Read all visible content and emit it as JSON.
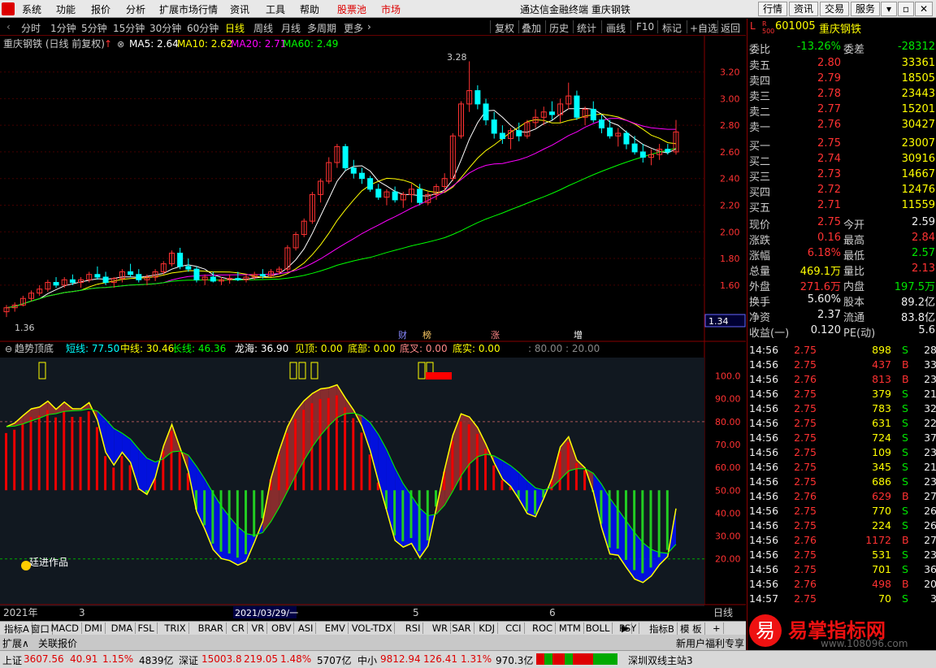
{
  "menu": {
    "items": [
      "系统",
      "功能",
      "报价",
      "分析",
      "扩展市场行情",
      "资讯",
      "工具",
      "帮助"
    ],
    "stock_pool": "股票池",
    "market": "市场",
    "title": "通达信金融终端  重庆钢铁",
    "right_buttons": [
      "行情",
      "资讯",
      "交易",
      "服务"
    ]
  },
  "toolbar": {
    "periods": [
      "分时",
      "1分钟",
      "5分钟",
      "15分钟",
      "30分钟",
      "60分钟",
      "日线",
      "周线",
      "月线",
      "多周期",
      "更多"
    ],
    "active": "日线",
    "tools": [
      "复权",
      "叠加",
      "历史",
      "统计",
      "画线",
      "F10",
      "标记",
      "+自选",
      "返回"
    ]
  },
  "main_chart": {
    "title": "重庆钢铁 (日线 前复权)",
    "ma5": "MA5: 2.64",
    "ma10": "MA10: 2.62",
    "ma20": "MA20: 2.71",
    "ma60": "MA60: 2.49",
    "high_label": "3.28",
    "low_label": "1.36",
    "price_axis": [
      "3.20",
      "3.00",
      "2.80",
      "2.60",
      "2.40",
      "2.20",
      "2.00",
      "1.80",
      "1.60"
    ],
    "current_price_box": "1.34",
    "event_tags": [
      "财",
      "榜",
      "涨",
      "增"
    ]
  },
  "indicator": {
    "name": "趋势顶底",
    "short": "短线: 77.50",
    "mid": "中线: 30.46",
    "long": "长线: 46.36",
    "dragon": "龙海: 36.90",
    "top": "见顶: 0.00",
    "bottom": "底部: 0.00",
    "cross": "底叉: 0.00",
    "real": "底实: 0.00",
    "ref": ": 80.00 : 20.00",
    "axis": [
      "100.0",
      "90.00",
      "80.00",
      "70.00",
      "60.00",
      "50.00",
      "40.00",
      "30.00",
      "20.00"
    ],
    "watermark": "廷进作品"
  },
  "date_axis": {
    "labels": [
      "2021年",
      "3",
      "2021/03/29/一",
      "5",
      "6"
    ],
    "period": "日线"
  },
  "chart_data": {
    "type": "candlestick",
    "title": "重庆钢铁 (日线 前复权)",
    "ylim": [
      1.3,
      3.35
    ],
    "candles": [
      [
        1.4,
        1.45,
        1.36,
        1.43
      ],
      [
        1.43,
        1.47,
        1.4,
        1.45
      ],
      [
        1.45,
        1.52,
        1.44,
        1.5
      ],
      [
        1.5,
        1.56,
        1.48,
        1.54
      ],
      [
        1.54,
        1.6,
        1.52,
        1.57
      ],
      [
        1.57,
        1.64,
        1.55,
        1.62
      ],
      [
        1.62,
        1.66,
        1.58,
        1.6
      ],
      [
        1.6,
        1.66,
        1.58,
        1.64
      ],
      [
        1.64,
        1.68,
        1.6,
        1.62
      ],
      [
        1.62,
        1.66,
        1.58,
        1.64
      ],
      [
        1.64,
        1.7,
        1.62,
        1.68
      ],
      [
        1.68,
        1.74,
        1.64,
        1.66
      ],
      [
        1.66,
        1.7,
        1.6,
        1.62
      ],
      [
        1.62,
        1.66,
        1.58,
        1.65
      ],
      [
        1.65,
        1.72,
        1.62,
        1.7
      ],
      [
        1.7,
        1.76,
        1.66,
        1.68
      ],
      [
        1.68,
        1.72,
        1.62,
        1.64
      ],
      [
        1.64,
        1.68,
        1.6,
        1.66
      ],
      [
        1.66,
        1.72,
        1.63,
        1.7
      ],
      [
        1.7,
        1.78,
        1.68,
        1.76
      ],
      [
        1.76,
        1.86,
        1.74,
        1.84
      ],
      [
        1.84,
        1.88,
        1.72,
        1.74
      ],
      [
        1.74,
        1.8,
        1.7,
        1.72
      ],
      [
        1.72,
        1.74,
        1.62,
        1.64
      ],
      [
        1.64,
        1.68,
        1.6,
        1.66
      ],
      [
        1.66,
        1.7,
        1.62,
        1.63
      ],
      [
        1.63,
        1.66,
        1.6,
        1.64
      ],
      [
        1.64,
        1.68,
        1.61,
        1.65
      ],
      [
        1.65,
        1.7,
        1.63,
        1.64
      ],
      [
        1.64,
        1.68,
        1.62,
        1.66
      ],
      [
        1.66,
        1.7,
        1.64,
        1.68
      ],
      [
        1.68,
        1.72,
        1.65,
        1.67
      ],
      [
        1.67,
        1.72,
        1.66,
        1.7
      ],
      [
        1.7,
        1.74,
        1.68,
        1.72
      ],
      [
        1.72,
        1.9,
        1.7,
        1.88
      ],
      [
        1.88,
        2.0,
        1.86,
        1.98
      ],
      [
        1.98,
        2.1,
        1.96,
        2.08
      ],
      [
        2.08,
        2.3,
        2.06,
        2.28
      ],
      [
        2.28,
        2.4,
        2.22,
        2.38
      ],
      [
        2.38,
        2.56,
        2.36,
        2.52
      ],
      [
        2.52,
        2.66,
        2.48,
        2.64
      ],
      [
        2.64,
        2.66,
        2.46,
        2.48
      ],
      [
        2.48,
        2.54,
        2.4,
        2.44
      ],
      [
        2.44,
        2.48,
        2.36,
        2.4
      ],
      [
        2.4,
        2.42,
        2.3,
        2.32
      ],
      [
        2.32,
        2.36,
        2.24,
        2.26
      ],
      [
        2.26,
        2.32,
        2.2,
        2.3
      ],
      [
        2.3,
        2.34,
        2.22,
        2.24
      ],
      [
        2.24,
        2.3,
        2.18,
        2.28
      ],
      [
        2.28,
        2.36,
        2.22,
        2.32
      ],
      [
        2.32,
        2.36,
        2.2,
        2.22
      ],
      [
        2.22,
        2.3,
        2.2,
        2.28
      ],
      [
        2.28,
        2.36,
        2.24,
        2.34
      ],
      [
        2.34,
        2.44,
        2.3,
        2.4
      ],
      [
        2.4,
        2.74,
        2.38,
        2.72
      ],
      [
        2.72,
        2.98,
        2.7,
        2.96
      ],
      [
        2.96,
        3.28,
        2.9,
        3.06
      ],
      [
        3.06,
        3.1,
        2.92,
        2.96
      ],
      [
        2.96,
        3.0,
        2.8,
        2.84
      ],
      [
        2.84,
        2.9,
        2.7,
        2.74
      ],
      [
        2.74,
        2.8,
        2.66,
        2.7
      ],
      [
        2.7,
        2.78,
        2.62,
        2.76
      ],
      [
        2.76,
        2.82,
        2.68,
        2.72
      ],
      [
        2.72,
        2.84,
        2.7,
        2.82
      ],
      [
        2.82,
        2.92,
        2.78,
        2.86
      ],
      [
        2.86,
        2.94,
        2.8,
        2.9
      ],
      [
        2.9,
        2.98,
        2.84,
        2.88
      ],
      [
        2.88,
        3.0,
        2.82,
        2.96
      ],
      [
        2.96,
        3.12,
        2.92,
        3.02
      ],
      [
        3.02,
        3.06,
        2.84,
        2.86
      ],
      [
        2.86,
        2.94,
        2.8,
        2.92
      ],
      [
        2.92,
        2.98,
        2.82,
        2.84
      ],
      [
        2.84,
        2.88,
        2.74,
        2.78
      ],
      [
        2.78,
        2.84,
        2.7,
        2.72
      ],
      [
        2.72,
        2.78,
        2.64,
        2.74
      ],
      [
        2.74,
        2.76,
        2.62,
        2.66
      ],
      [
        2.66,
        2.72,
        2.58,
        2.6
      ],
      [
        2.6,
        2.66,
        2.52,
        2.56
      ],
      [
        2.56,
        2.62,
        2.5,
        2.58
      ],
      [
        2.58,
        2.66,
        2.54,
        2.62
      ],
      [
        2.62,
        2.66,
        2.58,
        2.6
      ],
      [
        2.6,
        2.84,
        2.58,
        2.75
      ]
    ]
  },
  "quote": {
    "code": "601005",
    "name": "重庆钢铁",
    "weibi_label": "委比",
    "weibi": "-13.26%",
    "weicha_label": "委差",
    "weicha": "-28312",
    "asks": [
      {
        "label": "卖五",
        "price": "2.80",
        "vol": "33361"
      },
      {
        "label": "卖四",
        "price": "2.79",
        "vol": "18505"
      },
      {
        "label": "卖三",
        "price": "2.78",
        "vol": "23443"
      },
      {
        "label": "卖二",
        "price": "2.77",
        "vol": "15201"
      },
      {
        "label": "卖一",
        "price": "2.76",
        "vol": "30427"
      }
    ],
    "bids": [
      {
        "label": "买一",
        "price": "2.75",
        "vol": "23007"
      },
      {
        "label": "买二",
        "price": "2.74",
        "vol": "30916"
      },
      {
        "label": "买三",
        "price": "2.73",
        "vol": "14667"
      },
      {
        "label": "买四",
        "price": "2.72",
        "vol": "12476"
      },
      {
        "label": "买五",
        "price": "2.71",
        "vol": "11559"
      }
    ],
    "stats": [
      [
        "现价",
        "2.75",
        "今开",
        "2.59"
      ],
      [
        "涨跌",
        "0.16",
        "最高",
        "2.84"
      ],
      [
        "涨幅",
        "6.18%",
        "最低",
        "2.57"
      ],
      [
        "总量",
        "469.1万",
        "量比",
        "2.13"
      ],
      [
        "外盘",
        "271.6万",
        "内盘",
        "197.5万"
      ],
      [
        "换手",
        "5.60%",
        "股本",
        "89.2亿"
      ],
      [
        "净资",
        "2.37",
        "流通",
        "83.8亿"
      ],
      [
        "收益(一)",
        "0.120",
        "PE(动)",
        "5.6"
      ]
    ],
    "ticks": [
      [
        "14:56",
        "2.75",
        "898",
        "S",
        "28"
      ],
      [
        "14:56",
        "2.75",
        "437",
        "B",
        "33"
      ],
      [
        "14:56",
        "2.76",
        "813",
        "B",
        "23"
      ],
      [
        "14:56",
        "2.75",
        "379",
        "S",
        "21"
      ],
      [
        "14:56",
        "2.75",
        "783",
        "S",
        "32"
      ],
      [
        "14:56",
        "2.75",
        "631",
        "S",
        "22"
      ],
      [
        "14:56",
        "2.75",
        "724",
        "S",
        "37"
      ],
      [
        "14:56",
        "2.75",
        "109",
        "S",
        "23"
      ],
      [
        "14:56",
        "2.75",
        "345",
        "S",
        "21"
      ],
      [
        "14:56",
        "2.75",
        "686",
        "S",
        "23"
      ],
      [
        "14:56",
        "2.76",
        "629",
        "B",
        "27"
      ],
      [
        "14:56",
        "2.75",
        "770",
        "S",
        "26"
      ],
      [
        "14:56",
        "2.75",
        "224",
        "S",
        "26"
      ],
      [
        "14:56",
        "2.76",
        "1172",
        "B",
        "27"
      ],
      [
        "14:56",
        "2.75",
        "531",
        "S",
        "23"
      ],
      [
        "14:56",
        "2.75",
        "701",
        "S",
        "36"
      ],
      [
        "14:56",
        "2.76",
        "498",
        "B",
        "20"
      ],
      [
        "14:57",
        "2.75",
        "70",
        "S",
        "3"
      ]
    ]
  },
  "tabs": [
    "指标A",
    "窗口",
    "MACD",
    "DMI",
    "DMA",
    "FSL",
    "TRIX",
    "BRAR",
    "CR",
    "VR",
    "OBV",
    "ASI",
    "EMV",
    "VOL-TDX",
    "RSI",
    "WR",
    "SAR",
    "KDJ",
    "CCI",
    "ROC",
    "MTM",
    "BOLL",
    "PSY"
  ],
  "tabs_right": [
    "指标B",
    "模 板",
    "+"
  ],
  "bottom": {
    "expand": "扩展∧",
    "linked": "关联报价",
    "news": "新用户福利专享"
  },
  "status": {
    "sh_label": "上证",
    "sh": "3607.56",
    "sh_chg": "40.91",
    "sh_pct": "1.15%",
    "sh_amt": "4839亿",
    "sz_label": "深证",
    "sz": "15003.8",
    "sz_chg": "219.05",
    "sz_pct": "1.48%",
    "sz_amt": "5707亿",
    "zx_label": "中小",
    "zx": "9812.94",
    "zx_chg": "126.41",
    "zx_pct": "1.31%",
    "zx_amt": "970.3亿",
    "server": "深圳双线主站3"
  },
  "brand": {
    "name": "易掌指标网",
    "url": "www.108096.com",
    "char": "易"
  },
  "colors": {
    "up": "#ff3232",
    "down": "#00ffff",
    "ma5": "#ffffff",
    "ma10": "#ffff00",
    "ma20": "#ff00ff",
    "ma60": "#00ff00",
    "bg": "#000000"
  }
}
